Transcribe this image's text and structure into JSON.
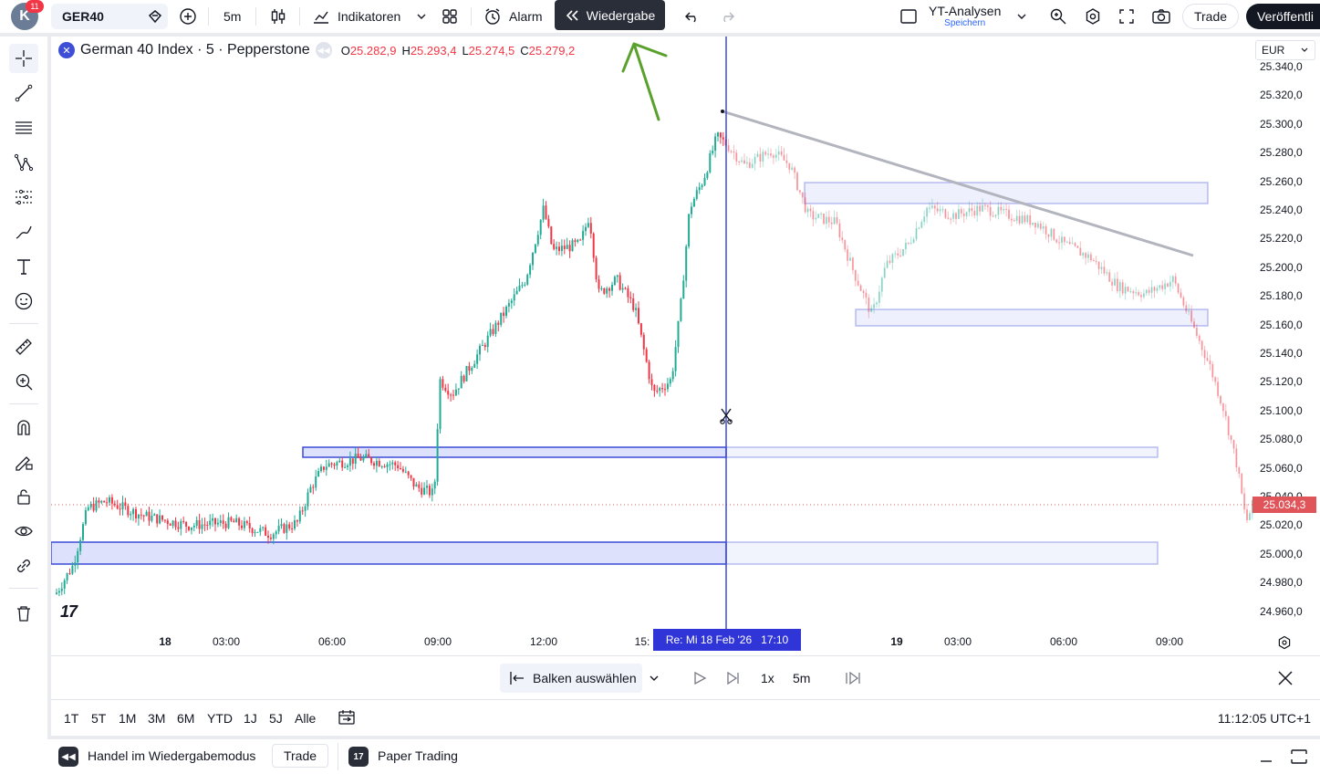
{
  "topbar": {
    "avatar_letter": "K",
    "notification_count": "11",
    "symbol": "GER40",
    "interval": "5m",
    "indicators_label": "Indikatoren",
    "alarm_label": "Alarm",
    "replay_label": "Wiedergabe",
    "layout_name": "YT-Analysen",
    "layout_status": "Speichern",
    "trade_label": "Trade",
    "publish_label": "Veröffentli"
  },
  "legend": {
    "title": "German 40 Index · 5 · Pepperstone",
    "open_label": "O",
    "open": "25.282,9",
    "high_label": "H",
    "high": "25.293,4",
    "low_label": "L",
    "low": "25.274,5",
    "close_label": "C",
    "close": "25.279,2"
  },
  "chart": {
    "currency": "EUR",
    "current_price": "25.034,3",
    "replay_cursor_date": "Re: Mi 18 Feb '26",
    "replay_cursor_time": "17:10",
    "y_ticks": [
      "25.340,0",
      "25.320,0",
      "25.300,0",
      "25.280,0",
      "25.260,0",
      "25.240,0",
      "25.220,0",
      "25.200,0",
      "25.180,0",
      "25.160,0",
      "25.140,0",
      "25.120,0",
      "25.100,0",
      "25.080,0",
      "25.060,0",
      "25.040,0",
      "25.020,0",
      "25.000,0",
      "24.980,0",
      "24.960,0"
    ],
    "x_ticks": [
      {
        "label": "18",
        "bold": true
      },
      {
        "label": "03:00",
        "bold": false
      },
      {
        "label": "06:00",
        "bold": false
      },
      {
        "label": "09:00",
        "bold": false
      },
      {
        "label": "12:00",
        "bold": false
      },
      {
        "label": "15:",
        "bold": false
      },
      {
        "label": "19",
        "bold": true
      },
      {
        "label": "03:00",
        "bold": false
      },
      {
        "label": "06:00",
        "bold": false
      },
      {
        "label": "09:00",
        "bold": false
      }
    ],
    "colors": {
      "up": "#22ab94",
      "down": "#f23645",
      "zone_fill": "#dde1fb",
      "zone_border": "#3b4bd8",
      "cursor": "#3f4ed6",
      "trendline": "#b2b5be"
    }
  },
  "replaybar": {
    "select_bars_label": "Balken auswählen",
    "speed": "1x",
    "interval": "5m"
  },
  "rangebar": {
    "ranges": [
      "1T",
      "5T",
      "1M",
      "3M",
      "6M",
      "YTD",
      "1J",
      "5J",
      "Alle"
    ],
    "clock": "11:12:05 UTC+1"
  },
  "bottombar": {
    "replay_mode_label": "Handel im Wiedergabemodus",
    "trade_label": "Trade",
    "paper_trading_label": "Paper Trading"
  }
}
